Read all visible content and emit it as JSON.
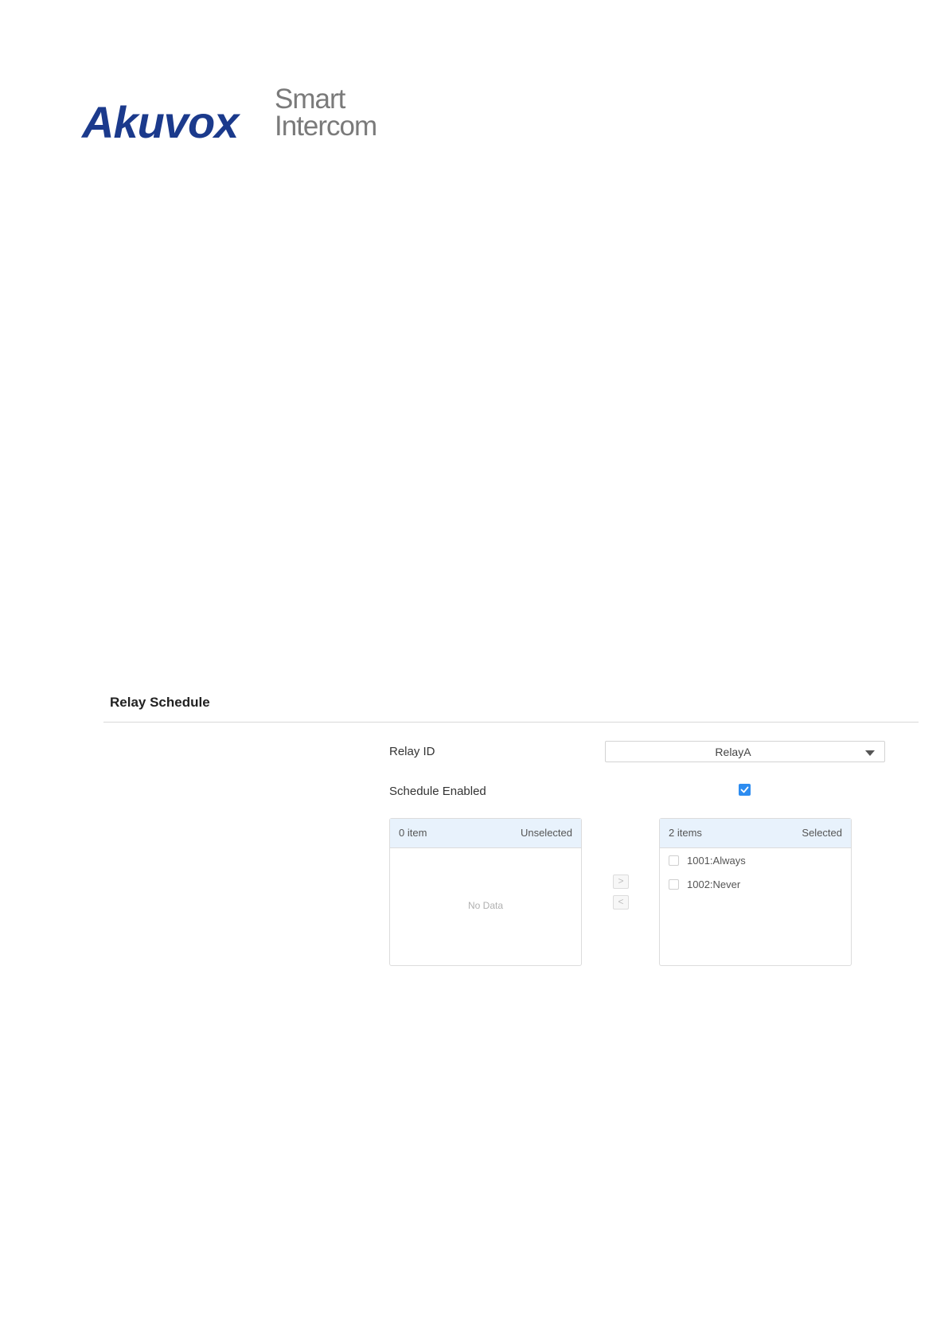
{
  "logo": {
    "brand": "Akuvox",
    "tagline_1": "Smart",
    "tagline_2": "Intercom"
  },
  "section": {
    "title": "Relay Schedule"
  },
  "form": {
    "relay_id_label": "Relay ID",
    "relay_id_value": "RelayA",
    "schedule_enabled_label": "Schedule Enabled",
    "schedule_enabled": true
  },
  "transfer": {
    "left": {
      "count": "0 item",
      "title": "Unselected",
      "empty_text": "No Data",
      "items": []
    },
    "right": {
      "count": "2 items",
      "title": "Selected",
      "items": [
        {
          "label": "1001:Always",
          "checked": false
        },
        {
          "label": "1002:Never",
          "checked": false
        }
      ]
    },
    "move_right_icon": ">",
    "move_left_icon": "<"
  },
  "colors": {
    "brand_blue": "#1b3a8c",
    "accent": "#2d8cf0",
    "panel_header": "#e8f2fc"
  }
}
